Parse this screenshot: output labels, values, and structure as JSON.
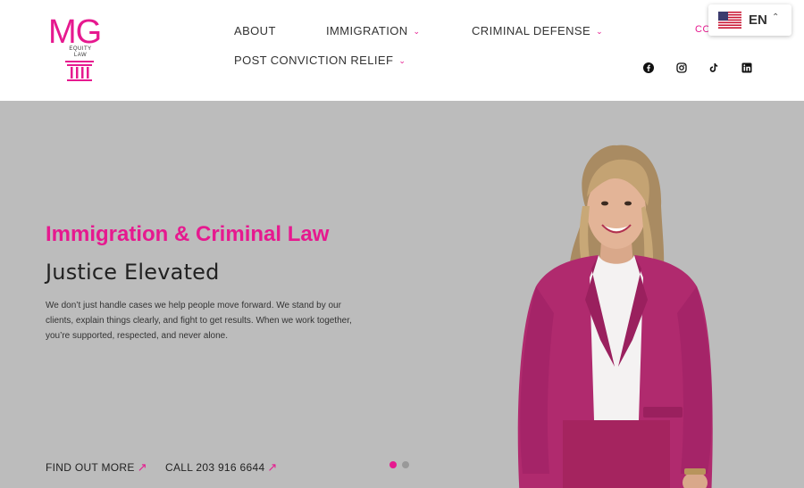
{
  "logo": {
    "mark": "MG",
    "line1": "EQUITY",
    "line2": "LAW"
  },
  "nav": {
    "items": [
      {
        "label": "ABOUT",
        "dropdown": false
      },
      {
        "label": "IMMIGRATION",
        "dropdown": true
      },
      {
        "label": "CRIMINAL DEFENSE",
        "dropdown": true
      },
      {
        "label": "POST CONVICTION RELIEF",
        "dropdown": true
      }
    ],
    "contact_partial": "CO"
  },
  "language": {
    "code": "EN",
    "flag": "us-flag-icon"
  },
  "social": [
    "facebook-icon",
    "instagram-icon",
    "tiktok-icon",
    "linkedin-icon"
  ],
  "hero": {
    "title": "Immigration & Criminal Law",
    "subtitle": "Justice Elevated",
    "body": "We don’t just handle cases we help people move forward. We stand by our clients, explain things clearly, and fight to get results. When we work together, you’re supported, respected, and never alone.",
    "cta_primary": "FIND OUT MORE",
    "cta_secondary": "CALL 203 916 6644",
    "slides": {
      "count": 2,
      "active": 1
    }
  },
  "colors": {
    "accent": "#e6198f",
    "hero_bg": "#bcbcbc",
    "text": "#333333"
  }
}
